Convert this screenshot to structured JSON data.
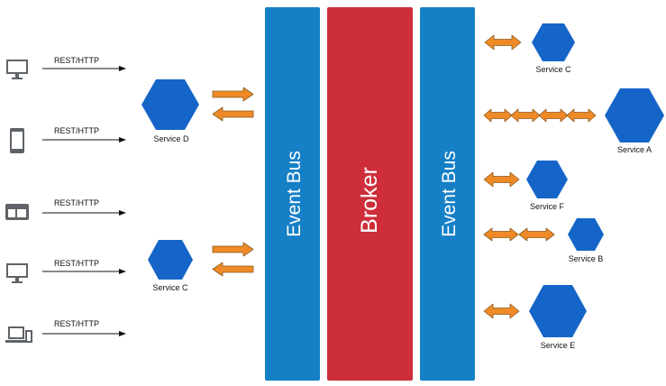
{
  "colors": {
    "event_bus": "#1580c6",
    "broker": "#cd2e3a",
    "service": "#1565c8",
    "arrow": "#ef8a26",
    "arrow_stroke": "#8a5a1e",
    "device": "#5f6368",
    "line": "#111111"
  },
  "bars": {
    "event_bus_left": "Event Bus",
    "broker": "Broker",
    "event_bus_right": "Event Bus"
  },
  "clients": [
    {
      "icon": "desktop-icon",
      "protocol": "REST/HTTP"
    },
    {
      "icon": "phone-icon",
      "protocol": "REST/HTTP"
    },
    {
      "icon": "browser-window-icon",
      "protocol": "REST/HTTP"
    },
    {
      "icon": "desktop-icon",
      "protocol": "REST/HTTP"
    },
    {
      "icon": "laptop-phone-icon",
      "protocol": "REST/HTTP"
    }
  ],
  "left_services": [
    {
      "label": "Service D"
    },
    {
      "label": "Service C"
    }
  ],
  "right_services": [
    {
      "label": "Service C",
      "arrow_count": 1
    },
    {
      "label": "Service A",
      "arrow_count": 4
    },
    {
      "label": "Service F",
      "arrow_count": 1
    },
    {
      "label": "Service B",
      "arrow_count": 2
    },
    {
      "label": "Service E",
      "arrow_count": 1
    }
  ]
}
